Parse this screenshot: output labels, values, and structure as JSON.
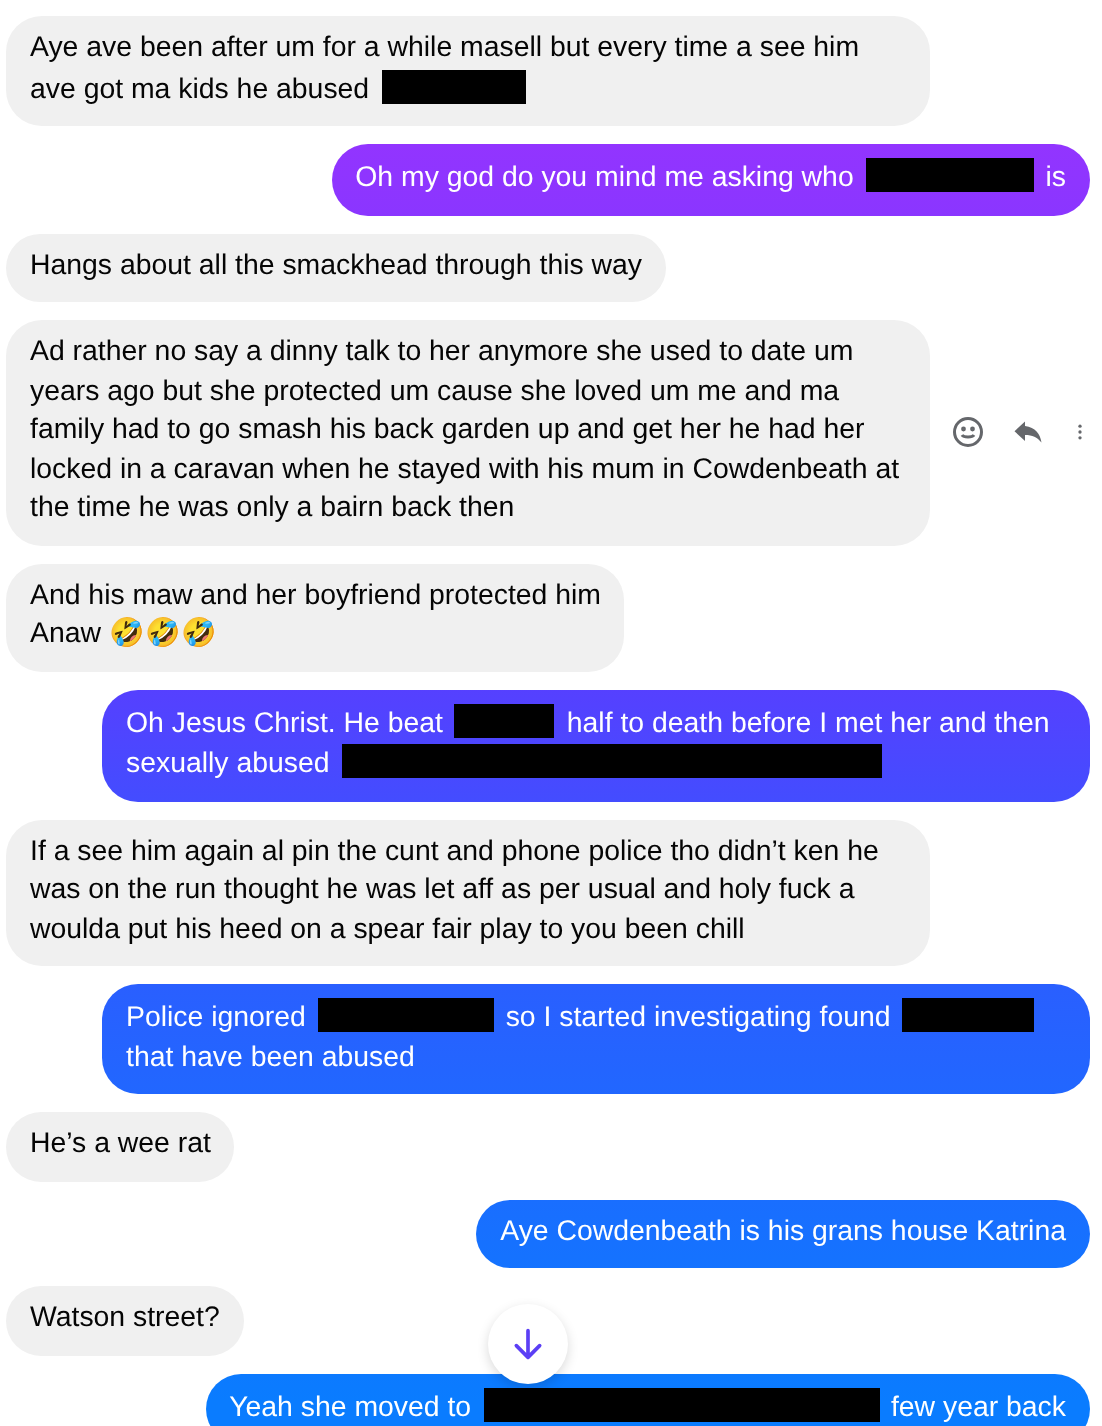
{
  "messages": [
    {
      "sent": false,
      "segments": [
        {
          "kind": "text",
          "text": "Aye ave been after um for a while masell but every time a see him ave got ma kids he abused"
        },
        {
          "kind": "redacted"
        }
      ]
    },
    {
      "sent": true,
      "segments": [
        {
          "kind": "text",
          "text": "Oh my god do you mind me asking who"
        },
        {
          "kind": "redacted"
        },
        {
          "kind": "text",
          "text": "is"
        }
      ]
    },
    {
      "sent": false,
      "segments": [
        {
          "kind": "text",
          "text": "Hangs about all the smackhead through this way"
        }
      ]
    },
    {
      "sent": false,
      "hovered": true,
      "segments": [
        {
          "kind": "text",
          "text": "Ad rather no say a dinny talk to her anymore she used to date um years ago but she protected um cause she loved um me and ma family had to go smash his back garden up and get her he had her locked in a caravan when he stayed with his mum in Cowdenbeath at the time he was only a bairn back then"
        }
      ]
    },
    {
      "sent": false,
      "segments": [
        {
          "kind": "text",
          "text": "And his maw and her boyfriend protected him"
        },
        {
          "kind": "break"
        },
        {
          "kind": "text",
          "text": "Anaw 🤣🤣🤣"
        }
      ]
    },
    {
      "sent": true,
      "segments": [
        {
          "kind": "text",
          "text": "Oh Jesus Christ. He beat"
        },
        {
          "kind": "redacted"
        },
        {
          "kind": "text",
          "text": "half to death before I met her and then sexually abused"
        },
        {
          "kind": "redacted"
        }
      ]
    },
    {
      "sent": false,
      "segments": [
        {
          "kind": "text",
          "text": "If a see him again al pin the cunt and phone police tho didn’t ken he was on the run thought he was let aff as per usual and holy fuck a woulda put his heed on a spear fair play to you been chill"
        }
      ]
    },
    {
      "sent": true,
      "segments": [
        {
          "kind": "text",
          "text": "Police ignored"
        },
        {
          "kind": "redacted"
        },
        {
          "kind": "text",
          "text": "so I started investigating found"
        },
        {
          "kind": "redacted"
        },
        {
          "kind": "text",
          "text": "that have been abused"
        }
      ]
    },
    {
      "sent": false,
      "segments": [
        {
          "kind": "text",
          "text": "He’s a wee rat"
        }
      ]
    },
    {
      "sent": true,
      "segments": [
        {
          "kind": "text",
          "text": "Aye Cowdenbeath is his grans house Katrina"
        }
      ]
    },
    {
      "sent": false,
      "segments": [
        {
          "kind": "text",
          "text": "Watson street?"
        }
      ]
    },
    {
      "sent": true,
      "segments": [
        {
          "kind": "text",
          "text": "Yeah she moved to"
        },
        {
          "kind": "redacted"
        },
        {
          "kind": "text",
          "text": "few year back"
        }
      ]
    }
  ]
}
